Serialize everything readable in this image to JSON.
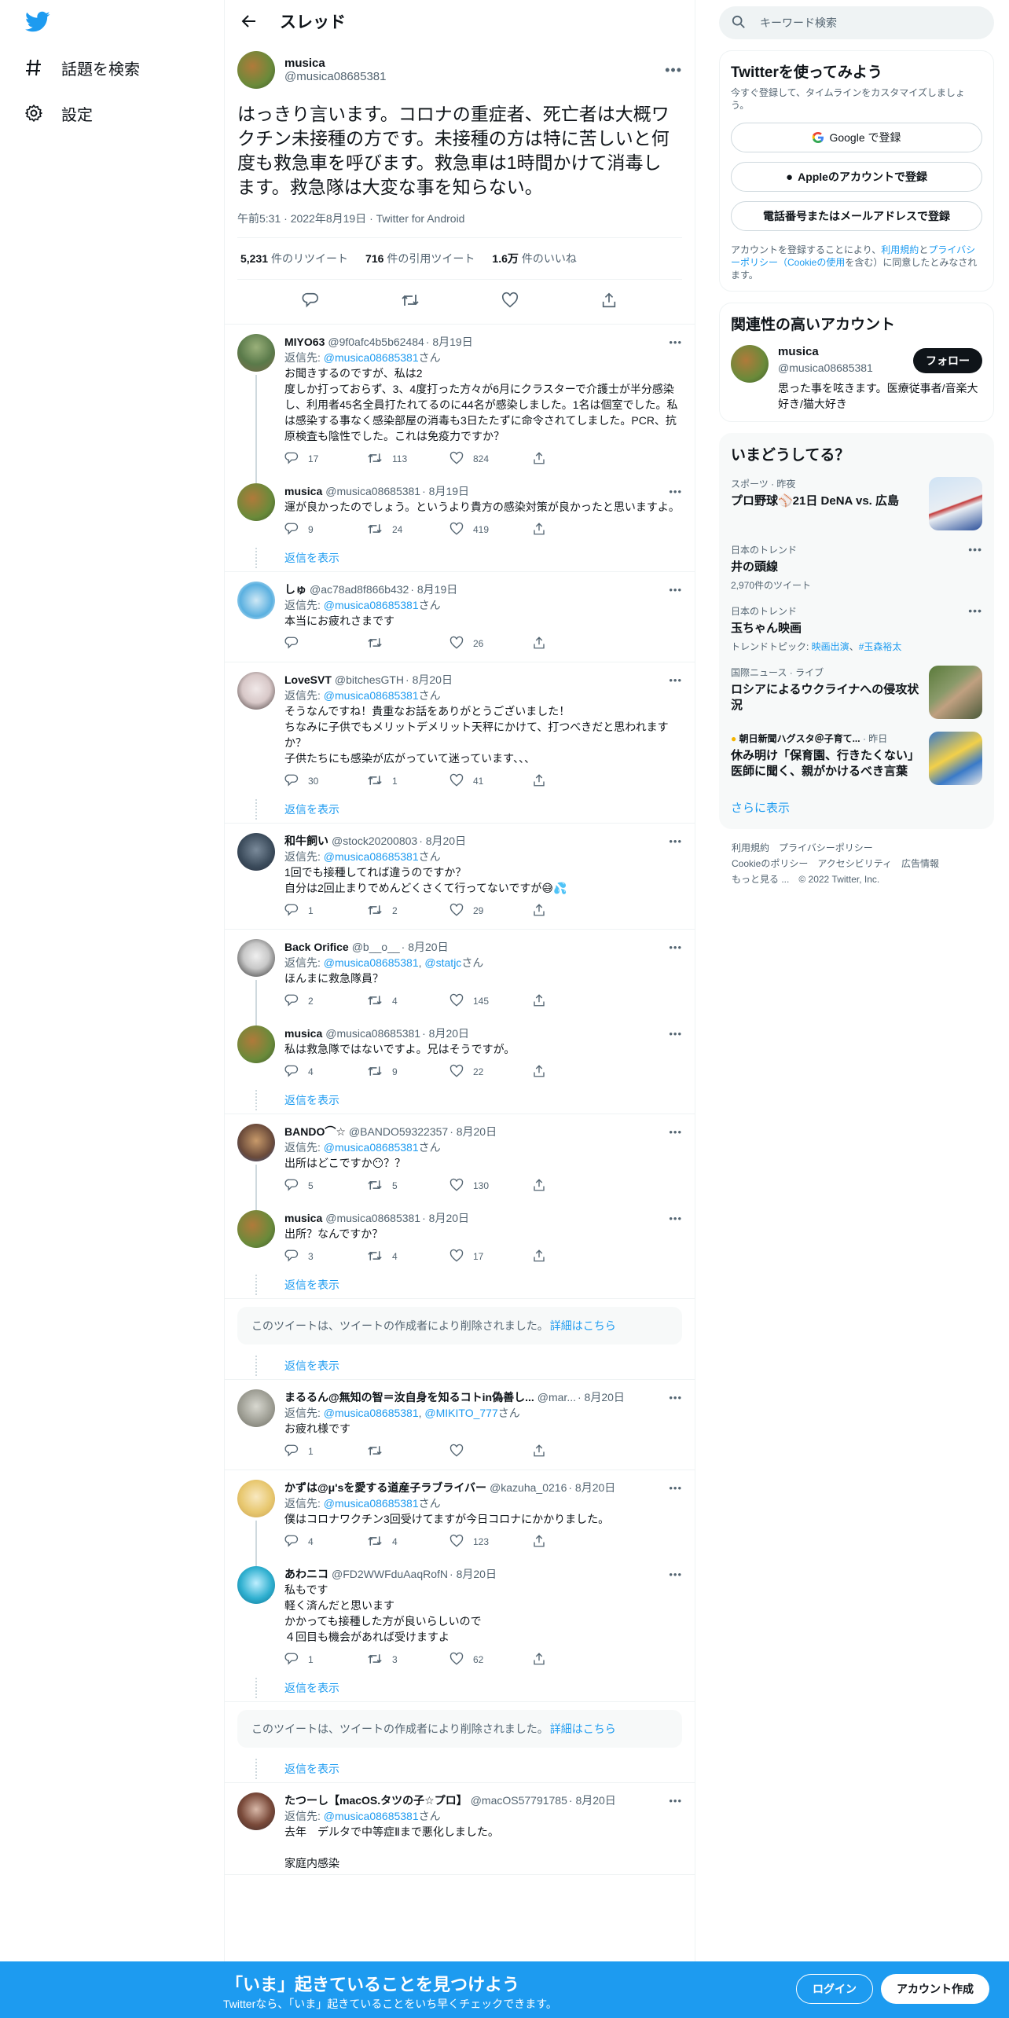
{
  "nav": {
    "explore": "話題を検索",
    "settings": "設定"
  },
  "header": {
    "title": "スレッド"
  },
  "main_tweet": {
    "name": "musica",
    "handle": "@musica08685381",
    "text": "はっきり言います。コロナの重症者、死亡者は大概ワクチン未接種の方です。未接種の方は特に苦しいと何度も救急車を呼びます。救急車は1時間かけて消毒し ます。救急隊は大変な事を知らない。",
    "meta": "午前5:31 · 2022年8月19日 · Twitter for Android",
    "retweets": "5,231",
    "retweets_label": "件のリツイート",
    "quotes": "716",
    "quotes_label": "件の引用ツイート",
    "likes": "1.6万",
    "likes_label": "件のいいね"
  },
  "reply_to_label": "返信先:",
  "san": "さん",
  "show_replies": "返信を表示",
  "deleted_text": "このツイートは、ツイートの作成者により削除されました。",
  "deleted_link": "詳細はこちら",
  "replies": [
    {
      "name": "MIYO63",
      "handle": "@9f0afc4b5b62484",
      "date": "· 8月19日",
      "to": "@musica08685381",
      "text": "お聞きするのですが、私は2\n度しか打っておらず、3、4度打った方々が6月にクラスターで介護士が半分感染し、利用者45名全員打たれてるのに44名が感染しました。1名は個室でした。私は感染する事なく感染部屋の消毒も3日たたずに命令されてしました。PCR、抗原検査も陰性でした。これは免疫力ですか？",
      "c": "17",
      "r": "113",
      "l": "824"
    },
    {
      "name": "musica",
      "handle": "@musica08685381",
      "date": "· 8月19日",
      "text": "運が良かったのでしょう。というより貴方の感染対策が良かったと思いますよ。",
      "c": "9",
      "r": "24",
      "l": "419"
    },
    {
      "name": "しゅ",
      "handle": "@ac78ad8f866b432",
      "date": "· 8月19日",
      "to": "@musica08685381",
      "text": "本当にお疲れさまです",
      "c": "",
      "r": "",
      "l": "26"
    },
    {
      "name": "LoveSVT",
      "handle": "@bitchesGTH",
      "date": "· 8月20日",
      "to": "@musica08685381",
      "text": "そうなんですね！貴重なお話をありがとうございました！\nちなみに子供でもメリットデメリット天秤にかけて、打つべきだと思われますか？\n子供たちにも感染が広がっていて迷っています、、、",
      "c": "30",
      "r": "1",
      "l": "41"
    },
    {
      "name": "和牛飼い",
      "handle": "@stock20200803",
      "date": "· 8月20日",
      "to": "@musica08685381",
      "text": "1回でも接種してれば違うのですか？\n自分は2回止まりでめんどくさくて行ってないですが😅💦",
      "c": "1",
      "r": "2",
      "l": "29"
    },
    {
      "name": "Back Orifice",
      "handle": "@b__o__",
      "date": "· 8月20日",
      "to": "@musica08685381",
      "to2": "@statjc",
      "text": "ほんまに救急隊員？",
      "c": "2",
      "r": "4",
      "l": "145"
    },
    {
      "name": "musica",
      "handle": "@musica08685381",
      "date": "· 8月20日",
      "text": "私は救急隊ではないですよ。兄はそうですが。",
      "c": "4",
      "r": "9",
      "l": "22"
    },
    {
      "name": "BANDO⌒☆",
      "handle": "@BANDO59322357",
      "date": "· 8月20日",
      "to": "@musica08685381",
      "text": "出所はどこですか😶？？",
      "c": "5",
      "r": "5",
      "l": "130"
    },
    {
      "name": "musica",
      "handle": "@musica08685381",
      "date": "· 8月20日",
      "text": "出所？なんですか？",
      "c": "3",
      "r": "4",
      "l": "17"
    },
    {
      "name": "まるるん@無知の智＝汝自身を知るコトin偽善し...",
      "handle": "@mar...",
      "date": "· 8月20日",
      "to": "@musica08685381",
      "to2": "@MIKITO_777",
      "text": "お疲れ様です",
      "c": "1",
      "r": "",
      "l": ""
    },
    {
      "name": "かずは@μ'sを愛する道産子ラブライバー",
      "handle": "@kazuha_0216",
      "date": "· 8月20日",
      "to": "@musica08685381",
      "text": "僕はコロナワクチン3回受けてますが今日コロナにかかりました。",
      "c": "4",
      "r": "4",
      "l": "123"
    },
    {
      "name": "あわニコ",
      "handle": "@FD2WWFduAaqRofN",
      "date": "· 8月20日",
      "text": "私もです\n軽く済んだと思います\nかかっても接種した方が良いらしいので\n４回目も機会があれば受けますよ",
      "c": "1",
      "r": "3",
      "l": "62"
    },
    {
      "name": "たつーし【macOS.タツの子☆プロ】",
      "handle": "@macOS57791785",
      "date": "· 8月20日",
      "to": "@musica08685381",
      "text": "去年　デルタで中等症Ⅱまで悪化しました。\n\n家庭内感染"
    }
  ],
  "right": {
    "search_placeholder": "キーワード検索",
    "signup_title": "Twitterを使ってみよう",
    "signup_sub": "今すぐ登録して、タイムラインをカスタマイズしましょう。",
    "google_btn": "Google で登録",
    "apple_btn": "Appleのアカウントで登録",
    "phone_btn": "電話番号またはメールアドレスで登録",
    "terms_1": "アカウントを登録することにより、",
    "terms_link1": "利用規約",
    "terms_2": "と",
    "terms_link2": "プライバシーポリシー（Cookieの使用",
    "terms_3": "を含む）に同意したとみなされます。",
    "related_title": "関連性の高いアカウント",
    "acc_name": "musica",
    "acc_handle": "@musica08685381",
    "acc_bio": "思った事を呟きます。医療従事者/音楽大好き/猫大好き",
    "follow": "フォロー",
    "trends_title": "いまどうしてる？",
    "trends": [
      {
        "ctx": "スポーツ · 昨夜",
        "name": "プロ野球⚾21日 DeNA vs. 広島"
      },
      {
        "ctx": "日本のトレンド",
        "name": "井の頭線",
        "meta": "2,970件のツイート"
      },
      {
        "ctx": "日本のトレンド",
        "name": "玉ちゃん映画",
        "meta_pre": "トレンドトピック: ",
        "meta_link1": "映画出演",
        "meta_sep": "、",
        "meta_link2": "#玉森裕太"
      },
      {
        "ctx": "国際ニュース · ライブ",
        "name": "ロシアによるウクライナへの侵攻状況"
      },
      {
        "ctx": "朝日新聞ハグスタ＠子育て...",
        "ctx2": "· 昨日",
        "name": "休み明け「保育園、行きたくない」　医師に聞く、親がかけるべき言葉"
      }
    ],
    "show_more": "さらに表示",
    "footer": [
      "利用規約",
      "プライバシーポリシー",
      "Cookieのポリシー",
      "アクセシビリティ",
      "広告情報",
      "もっと見る ...",
      "© 2022 Twitter, Inc."
    ]
  },
  "bottom": {
    "headline": "「いま」起きていることを見つけよう",
    "sub": "Twitterなら、「いま」起きていることをいち早くチェックできます。",
    "login": "ログイン",
    "signup": "アカウント作成"
  },
  "colors": {
    "accent": "#1d9bf0",
    "text": "#0f1419",
    "secondary": "#536471"
  }
}
